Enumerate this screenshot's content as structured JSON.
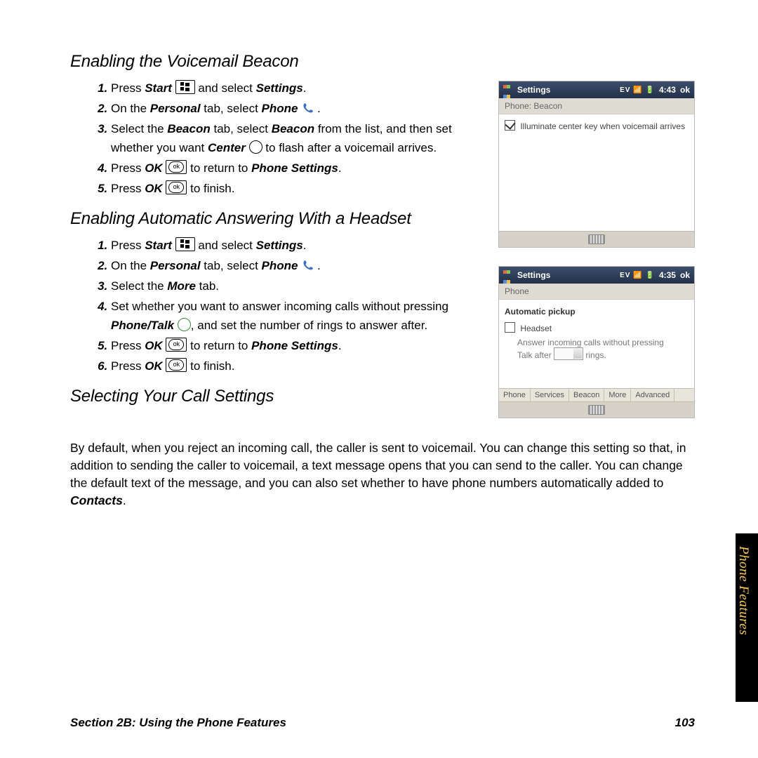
{
  "headings": {
    "h1": "Enabling the Voicemail Beacon",
    "h2": "Enabling Automatic Answering With a Headset",
    "h3": "Selecting Your Call Settings"
  },
  "section1": {
    "s1a": "Press ",
    "s1b": "Start",
    "s1c": " and select ",
    "s1d": "Settings",
    "s1e": ".",
    "s2a": "On the ",
    "s2b": "Personal",
    "s2c": " tab, select ",
    "s2d": "Phone",
    "s2e": " .",
    "s3a": "Select the ",
    "s3b": "Beacon",
    "s3c": " tab, select ",
    "s3d": "Beacon",
    "s3e": " from the list, and then set whether you want ",
    "s3f": "Center",
    "s3g": " to flash after a voicemail arrives.",
    "s4a": "Press ",
    "s4b": "OK",
    "s4c": " to return to ",
    "s4d": "Phone Settings",
    "s4e": ".",
    "s5a": "Press ",
    "s5b": "OK",
    "s5c": " to finish."
  },
  "section2": {
    "s1a": "Press ",
    "s1b": "Start",
    "s1c": " and select ",
    "s1d": "Settings",
    "s1e": ".",
    "s2a": "On the ",
    "s2b": "Personal",
    "s2c": " tab, select ",
    "s2d": "Phone",
    "s2e": " .",
    "s3a": "Select the ",
    "s3b": "More",
    "s3c": " tab.",
    "s4a": "Set whether you want to answer incoming calls without pressing ",
    "s4b": "Phone/Talk",
    "s4c": ", and set the number of rings to answer after.",
    "s5a": "Press ",
    "s5b": "OK",
    "s5c": " to return to ",
    "s5d": "Phone Settings",
    "s5e": ".",
    "s6a": "Press ",
    "s6b": "OK",
    "s6c": " to finish."
  },
  "paragraph": {
    "p1": "By default, when you reject an incoming call, the caller is sent to voicemail. You can change this setting so that, in addition to sending the caller to voicemail, a text message opens that you can send to the caller. You can change the default text of the message, and you can also set whether to have phone numbers automatically added to ",
    "p2": "Contacts",
    "p3": "."
  },
  "footer": {
    "left": "Section 2B: Using the Phone Features",
    "right": "103"
  },
  "sidetab": "Phone Features",
  "fig1": {
    "title": "Settings",
    "time": "4:43",
    "ok": "ok",
    "subbar": "Phone: Beacon",
    "checkbox": "Illuminate center key when voicemail arrives"
  },
  "fig2": {
    "title": "Settings",
    "time": "4:35",
    "ok": "ok",
    "subbar": "Phone",
    "sectitle": "Automatic pickup",
    "headset": "Headset",
    "answer": "Answer incoming calls without pressing",
    "talkafter_a": "Talk after",
    "talkafter_b": "rings.",
    "tabs": [
      "Phone",
      "Services",
      "Beacon",
      "More",
      "Advanced"
    ]
  },
  "status_icons": "EV 📶 🔋"
}
